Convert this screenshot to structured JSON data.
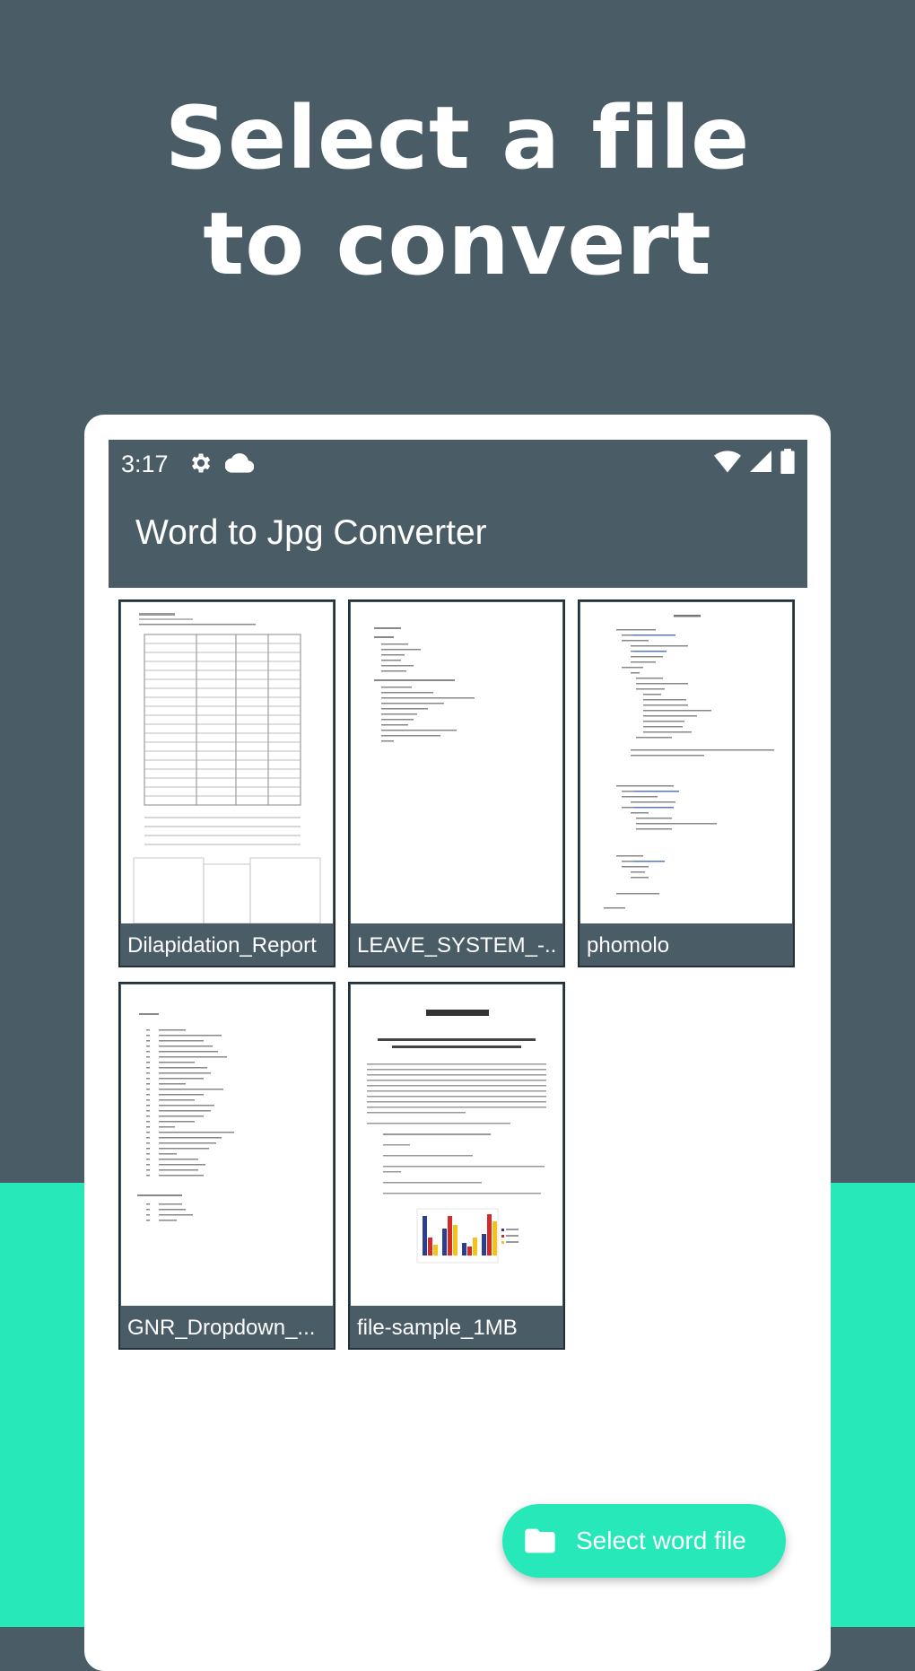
{
  "headline": {
    "line1": "Select a file",
    "line2": "to convert"
  },
  "status_bar": {
    "time": "3:17",
    "left_icons": [
      "gear-icon",
      "cloud-icon"
    ],
    "right_icons": [
      "wifi-icon",
      "signal-icon",
      "battery-icon"
    ]
  },
  "app": {
    "title": "Word to Jpg Converter"
  },
  "files": [
    {
      "name": "Dilapidation_Report",
      "preview": "form-table"
    },
    {
      "name": "LEAVE_SYSTEM_-...",
      "preview": "text-list"
    },
    {
      "name": "phomolo",
      "preview": "code"
    },
    {
      "name": "GNR_Dropdown_...",
      "preview": "numbered-list"
    },
    {
      "name": "file-sample_1MB",
      "preview": "article-with-chart"
    }
  ],
  "fab": {
    "label": "Select word file",
    "icon": "folder-icon"
  },
  "colors": {
    "primary": "#4a5c66",
    "accent": "#27e8b8",
    "background": "#ffffff"
  }
}
